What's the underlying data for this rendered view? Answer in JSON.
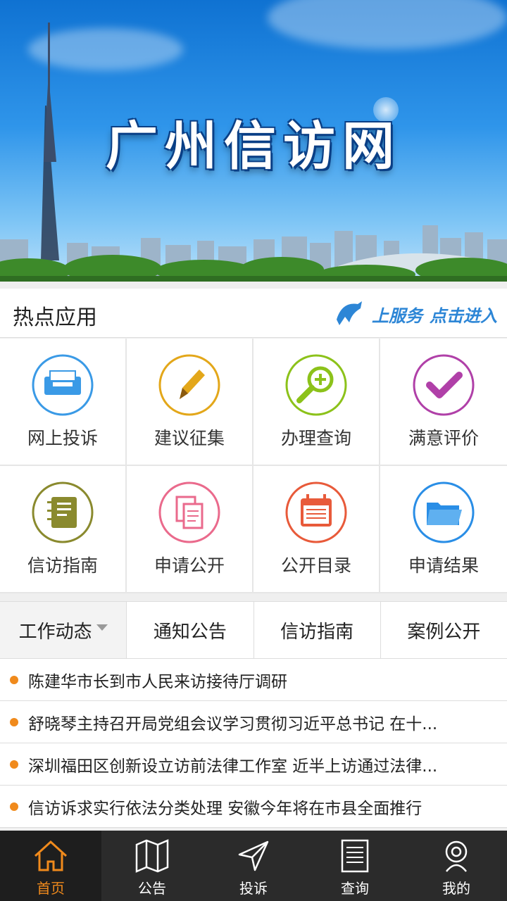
{
  "banner": {
    "title": "广州信访网"
  },
  "hot": {
    "label": "热点应用",
    "service_text": "上服务",
    "enter_text": "点击进入",
    "apps": [
      {
        "label": "网上投诉",
        "icon": "inbox-icon",
        "color": "#3a9ae6"
      },
      {
        "label": "建议征集",
        "icon": "pencil-icon",
        "color": "#e3a71a"
      },
      {
        "label": "办理查询",
        "icon": "magnifier-icon",
        "color": "#8cc21a"
      },
      {
        "label": "满意评价",
        "icon": "checkmark-icon",
        "color": "#b040a8"
      },
      {
        "label": "信访指南",
        "icon": "notebook-icon",
        "color": "#8a8a2e"
      },
      {
        "label": "申请公开",
        "icon": "documents-icon",
        "color": "#ea6a8c"
      },
      {
        "label": "公开目录",
        "icon": "calendar-list-icon",
        "color": "#e85a3a"
      },
      {
        "label": "申请结果",
        "icon": "folder-icon",
        "color": "#2a8ee6"
      }
    ]
  },
  "tabs": [
    {
      "label": "工作动态",
      "active": true
    },
    {
      "label": "通知公告"
    },
    {
      "label": "信访指南"
    },
    {
      "label": "案例公开"
    }
  ],
  "news": [
    "陈建华市长到市人民来访接待厅调研",
    "舒晓琴主持召开局党组会议学习贯彻习近平总书记  在十...",
    "深圳福田区创新设立访前法律工作室  近半上访通过法律...",
    "信访诉求实行依法分类处理  安徽今年将在市县全面推行"
  ],
  "nav": [
    {
      "label": "首页",
      "icon": "home-icon",
      "active": true
    },
    {
      "label": "公告",
      "icon": "map-icon"
    },
    {
      "label": "投诉",
      "icon": "send-icon"
    },
    {
      "label": "查询",
      "icon": "document-icon"
    },
    {
      "label": "我的",
      "icon": "user-icon"
    }
  ],
  "colors": {
    "accent": "#f08a1c",
    "nav_bg": "#2b2b2b",
    "service_blue": "#2d86d6"
  }
}
